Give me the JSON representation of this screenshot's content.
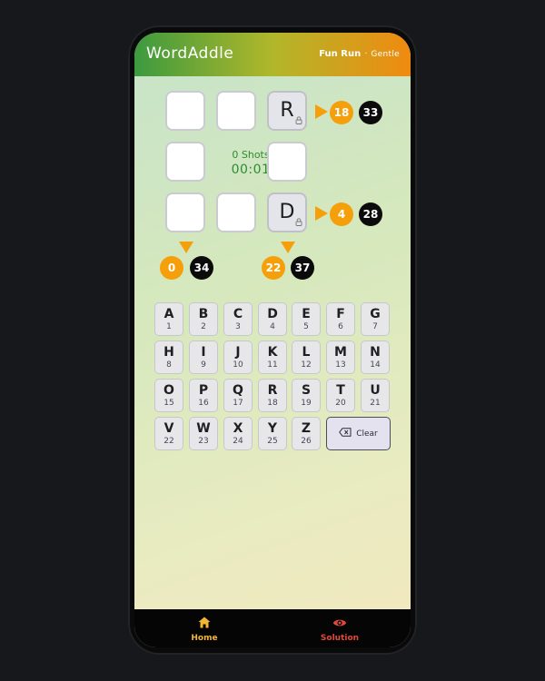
{
  "header": {
    "title": "WordAddle",
    "mode": "Fun Run",
    "separator": "·",
    "difficulty": "Gentle"
  },
  "grid": {
    "tiles": [
      {
        "letter": "",
        "locked": false
      },
      {
        "letter": "",
        "locked": false
      },
      {
        "letter": "R",
        "locked": true
      },
      {
        "letter": "",
        "locked": false
      },
      {
        "letter": "",
        "locked": false
      },
      {
        "letter": "",
        "locked": false
      },
      {
        "letter": "",
        "locked": false
      },
      {
        "letter": "D",
        "locked": true
      }
    ],
    "row_sums": [
      {
        "current": "18",
        "target": "33"
      },
      {
        "current": "4",
        "target": "28"
      }
    ],
    "col_sums": [
      {
        "current": "0",
        "target": "34"
      },
      {
        "current": "22",
        "target": "37"
      }
    ],
    "shots": "0 Shots",
    "timer": "00:01"
  },
  "keyboard": {
    "keys": [
      {
        "letter": "A",
        "value": "1"
      },
      {
        "letter": "B",
        "value": "2"
      },
      {
        "letter": "C",
        "value": "3"
      },
      {
        "letter": "D",
        "value": "4"
      },
      {
        "letter": "E",
        "value": "5"
      },
      {
        "letter": "F",
        "value": "6"
      },
      {
        "letter": "G",
        "value": "7"
      },
      {
        "letter": "H",
        "value": "8"
      },
      {
        "letter": "I",
        "value": "9"
      },
      {
        "letter": "J",
        "value": "10"
      },
      {
        "letter": "K",
        "value": "11"
      },
      {
        "letter": "L",
        "value": "12"
      },
      {
        "letter": "M",
        "value": "13"
      },
      {
        "letter": "N",
        "value": "14"
      },
      {
        "letter": "O",
        "value": "15"
      },
      {
        "letter": "P",
        "value": "16"
      },
      {
        "letter": "Q",
        "value": "17"
      },
      {
        "letter": "R",
        "value": "18"
      },
      {
        "letter": "S",
        "value": "19"
      },
      {
        "letter": "T",
        "value": "20"
      },
      {
        "letter": "U",
        "value": "21"
      },
      {
        "letter": "V",
        "value": "22"
      },
      {
        "letter": "W",
        "value": "23"
      },
      {
        "letter": "X",
        "value": "24"
      },
      {
        "letter": "Y",
        "value": "25"
      },
      {
        "letter": "Z",
        "value": "26"
      }
    ],
    "clear_label": "Clear"
  },
  "nav": {
    "home_label": "Home",
    "solution_label": "Solution"
  },
  "colors": {
    "accent": "#f5a00b",
    "home": "#f2b632",
    "solution": "#e0493a"
  }
}
